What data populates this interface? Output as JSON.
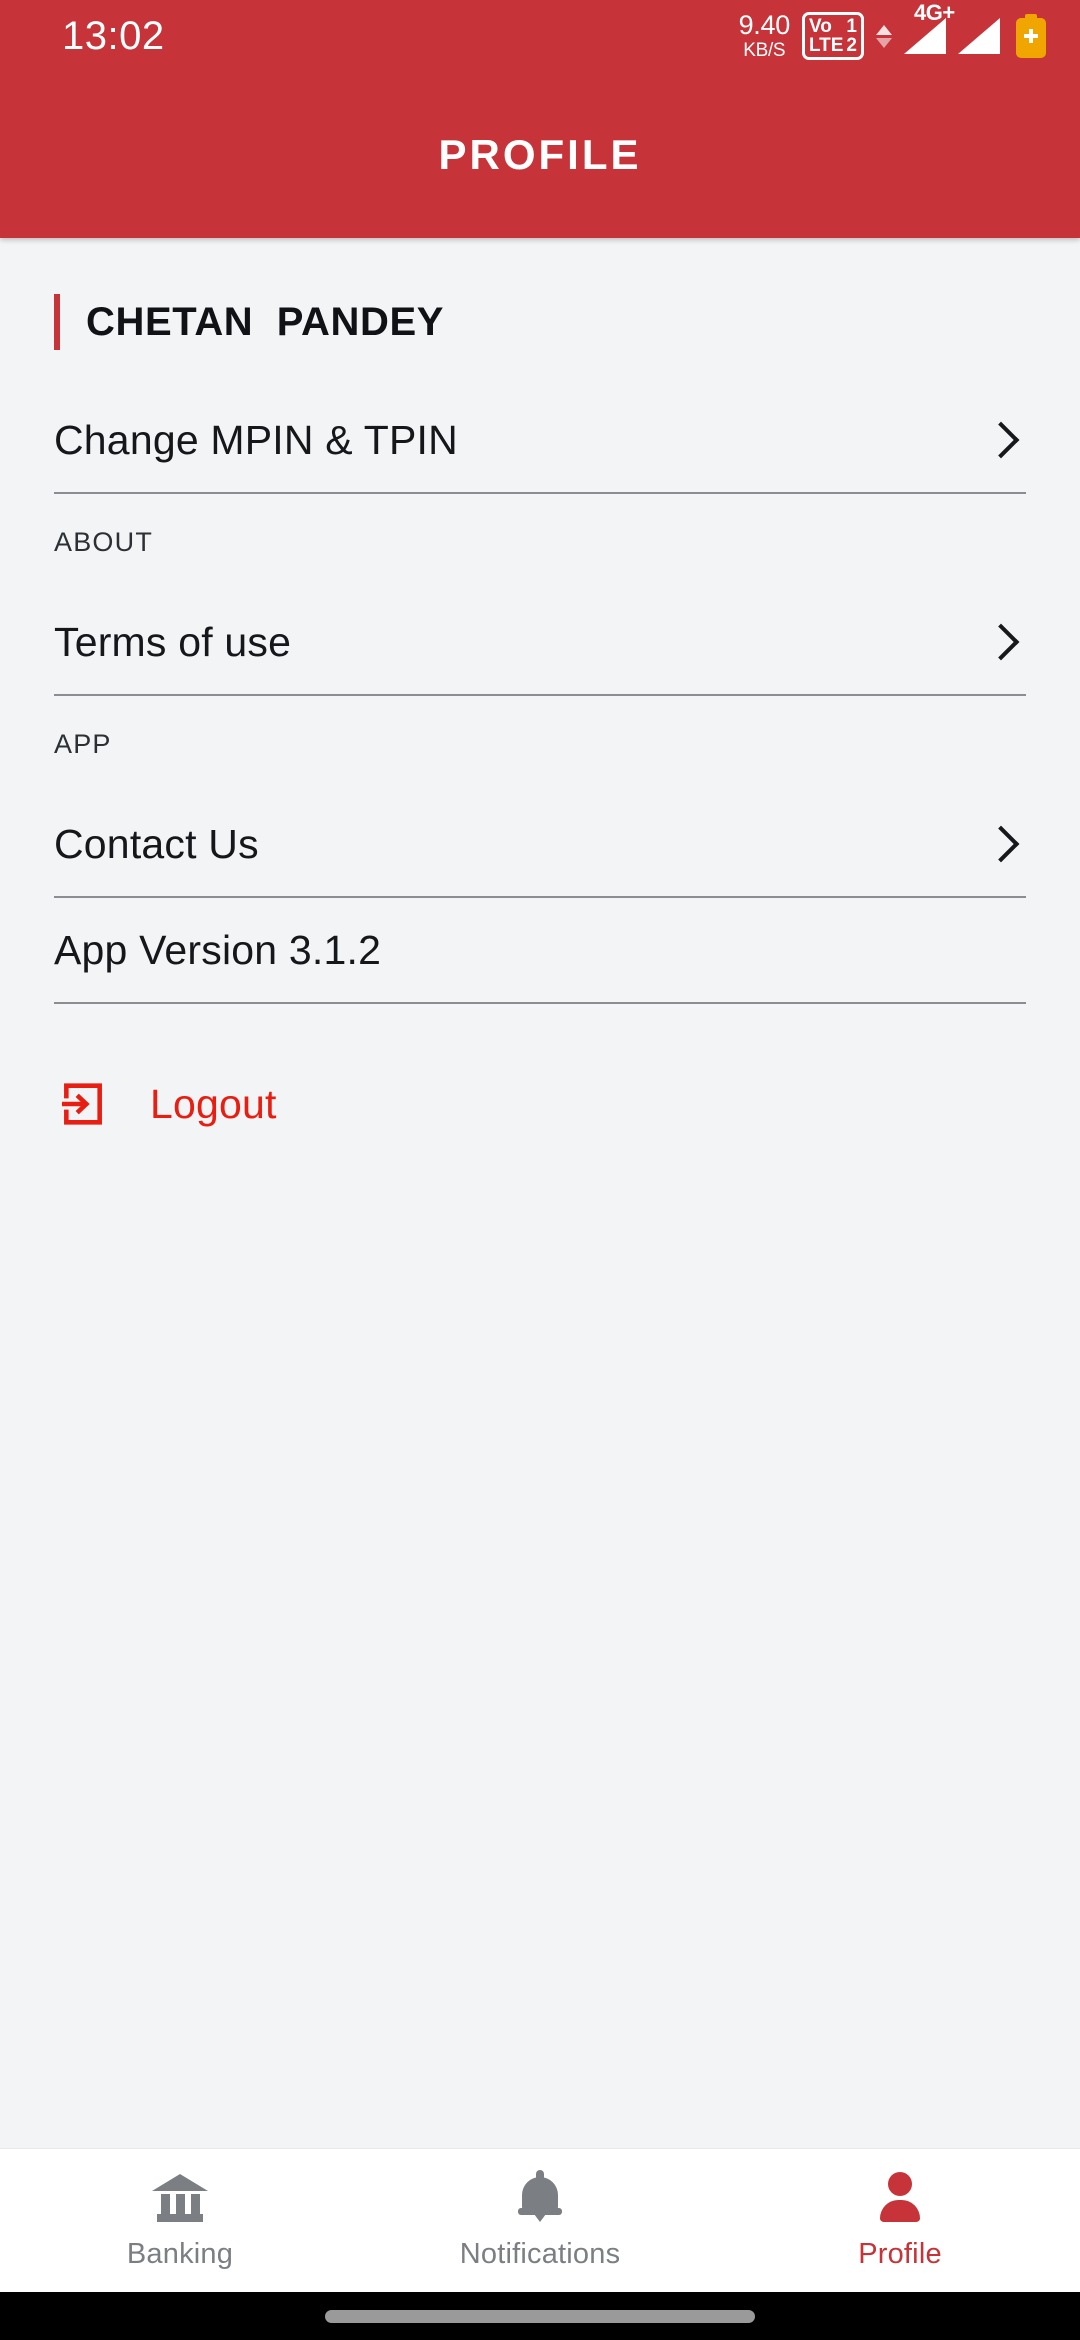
{
  "status_bar": {
    "time": "13:02",
    "network_speed_value": "9.40",
    "network_speed_unit": "KB/S",
    "volte_label_top": "Vo",
    "volte_label_bottom": "LTE",
    "sim1": "1",
    "sim2": "2",
    "network_type": "4G+",
    "icons": [
      "updown-arrows-icon",
      "signal-bars-icon",
      "signal-bars-icon",
      "battery-icon"
    ]
  },
  "header": {
    "title": "PROFILE",
    "background_color": "#C63338",
    "title_color": "#FFFFFF"
  },
  "profile": {
    "user_name": "CHETAN  PANDEY",
    "accent_color": "#C63338"
  },
  "menu": {
    "change_pin": {
      "label": "Change MPIN & TPIN",
      "has_chevron": true
    },
    "sections": [
      {
        "heading": "ABOUT",
        "rows": [
          {
            "label": "Terms of use",
            "has_chevron": true
          }
        ]
      },
      {
        "heading": "APP",
        "rows": [
          {
            "label": "Contact Us",
            "has_chevron": true
          },
          {
            "label": "App Version 3.1.2",
            "has_chevron": false
          }
        ]
      }
    ]
  },
  "logout": {
    "label": "Logout",
    "color": "#E81E12",
    "icon": "logout-icon"
  },
  "bottom_nav": {
    "items": [
      {
        "label": "Banking",
        "icon": "bank-icon",
        "active": false
      },
      {
        "label": "Notifications",
        "icon": "bell-icon",
        "active": false
      },
      {
        "label": "Profile",
        "icon": "person-icon",
        "active": true
      }
    ],
    "active_color": "#C63338",
    "inactive_color": "#7B7F84"
  }
}
